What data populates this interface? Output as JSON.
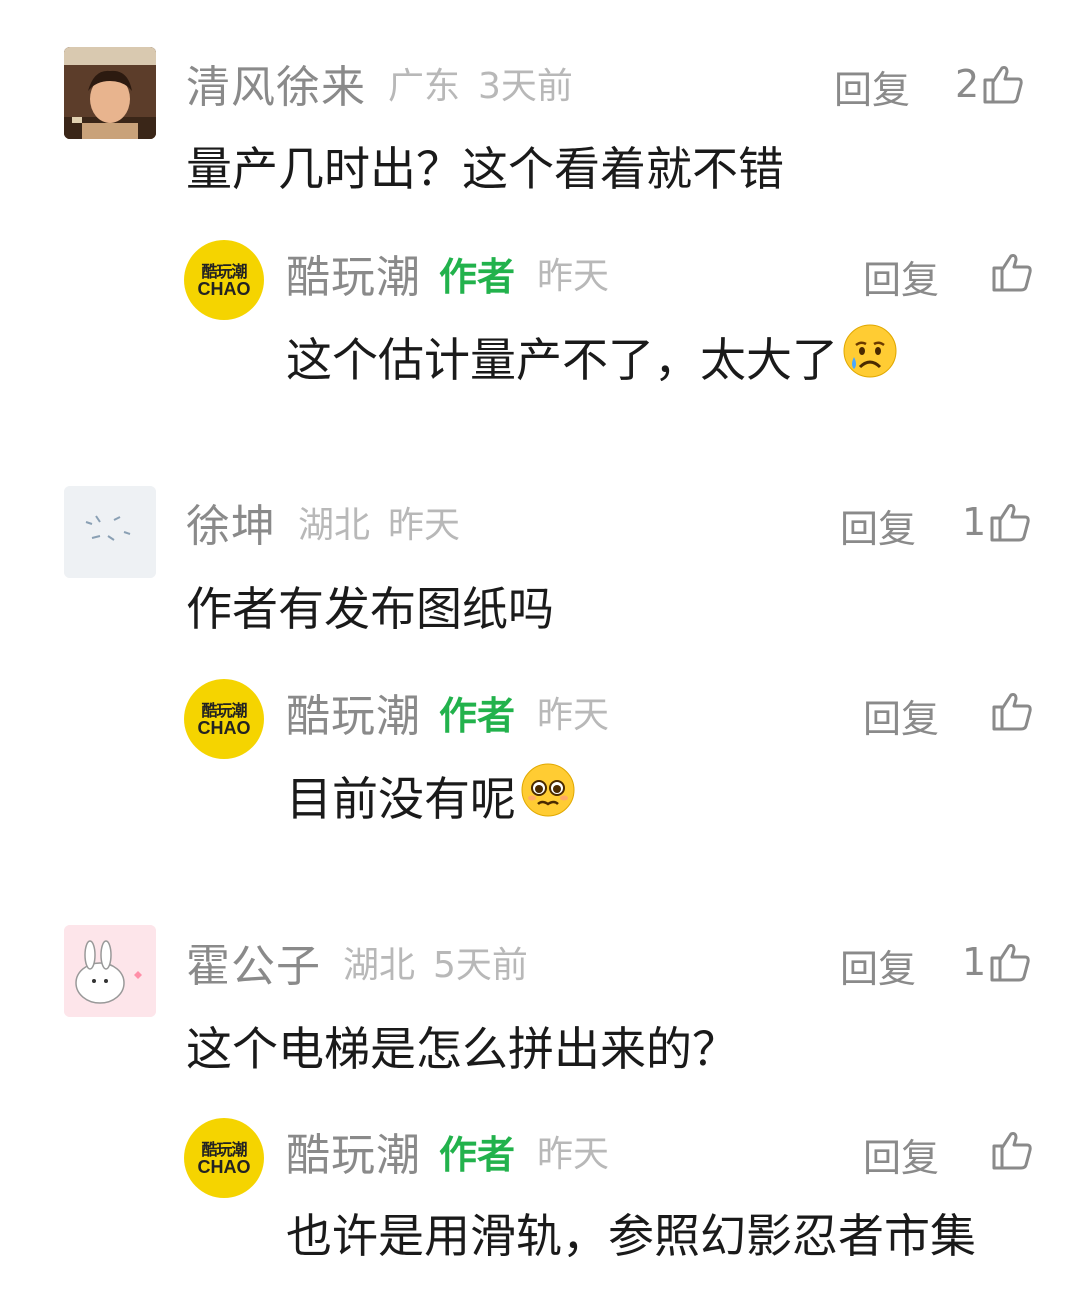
{
  "reply_label": "回复",
  "threads": [
    {
      "user": "清风徐来",
      "location": "广东",
      "time": "3天前",
      "likes": "2",
      "text": "量产几时出？这个看着就不错",
      "reply": {
        "user": "酷玩潮",
        "badge": "作者",
        "time": "昨天",
        "likes": "",
        "text": "这个估计量产不了，太大了",
        "emoji": "crying-face"
      }
    },
    {
      "user": "徐坤",
      "location": "湖北",
      "time": "昨天",
      "likes": "1",
      "text": "作者有发布图纸吗",
      "reply": {
        "user": "酷玩潮",
        "badge": "作者",
        "time": "昨天",
        "likes": "",
        "text": "目前没有呢",
        "emoji": "pleading-face"
      }
    },
    {
      "user": "霍公子",
      "location": "湖北",
      "time": "5天前",
      "likes": "1",
      "text": "这个电梯是怎么拼出来的？",
      "reply": {
        "user": "酷玩潮",
        "badge": "作者",
        "time": "昨天",
        "likes": "",
        "text": "也许是用滑轨，参照幻影忍者市集",
        "emoji": ""
      }
    }
  ],
  "author_avatar": {
    "line1": "酷玩潮",
    "line2": "CHAO",
    "color": "#f5d400"
  },
  "colors": {
    "author_badge": "#22b24c",
    "meta": "#b8b8b8",
    "name": "#8a8a8a",
    "text": "#1a1a1a"
  }
}
